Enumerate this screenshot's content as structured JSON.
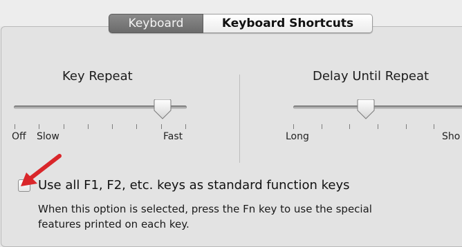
{
  "tabs": {
    "keyboard": "Keyboard",
    "shortcuts": "Keyboard Shortcuts",
    "active": "Keyboard"
  },
  "key_repeat": {
    "title": "Key Repeat",
    "label_off": "Off",
    "label_slow": "Slow",
    "label_fast": "Fast",
    "tick_count": 8,
    "value_fraction": 0.86
  },
  "delay_until_repeat": {
    "title": "Delay Until Repeat",
    "label_long": "Long",
    "label_short": "Sho",
    "value_fraction": 0.42
  },
  "function_keys": {
    "label": "Use all F1, F2, etc. keys as standard function keys",
    "checked": false,
    "help_line1": "When this option is selected, press the Fn key to use the special",
    "help_line2": "features printed on each key."
  },
  "colors": {
    "annotation_arrow": "#d9262a",
    "active_tab": "#7a7a7a",
    "panel_background": "#e3e3e3"
  }
}
